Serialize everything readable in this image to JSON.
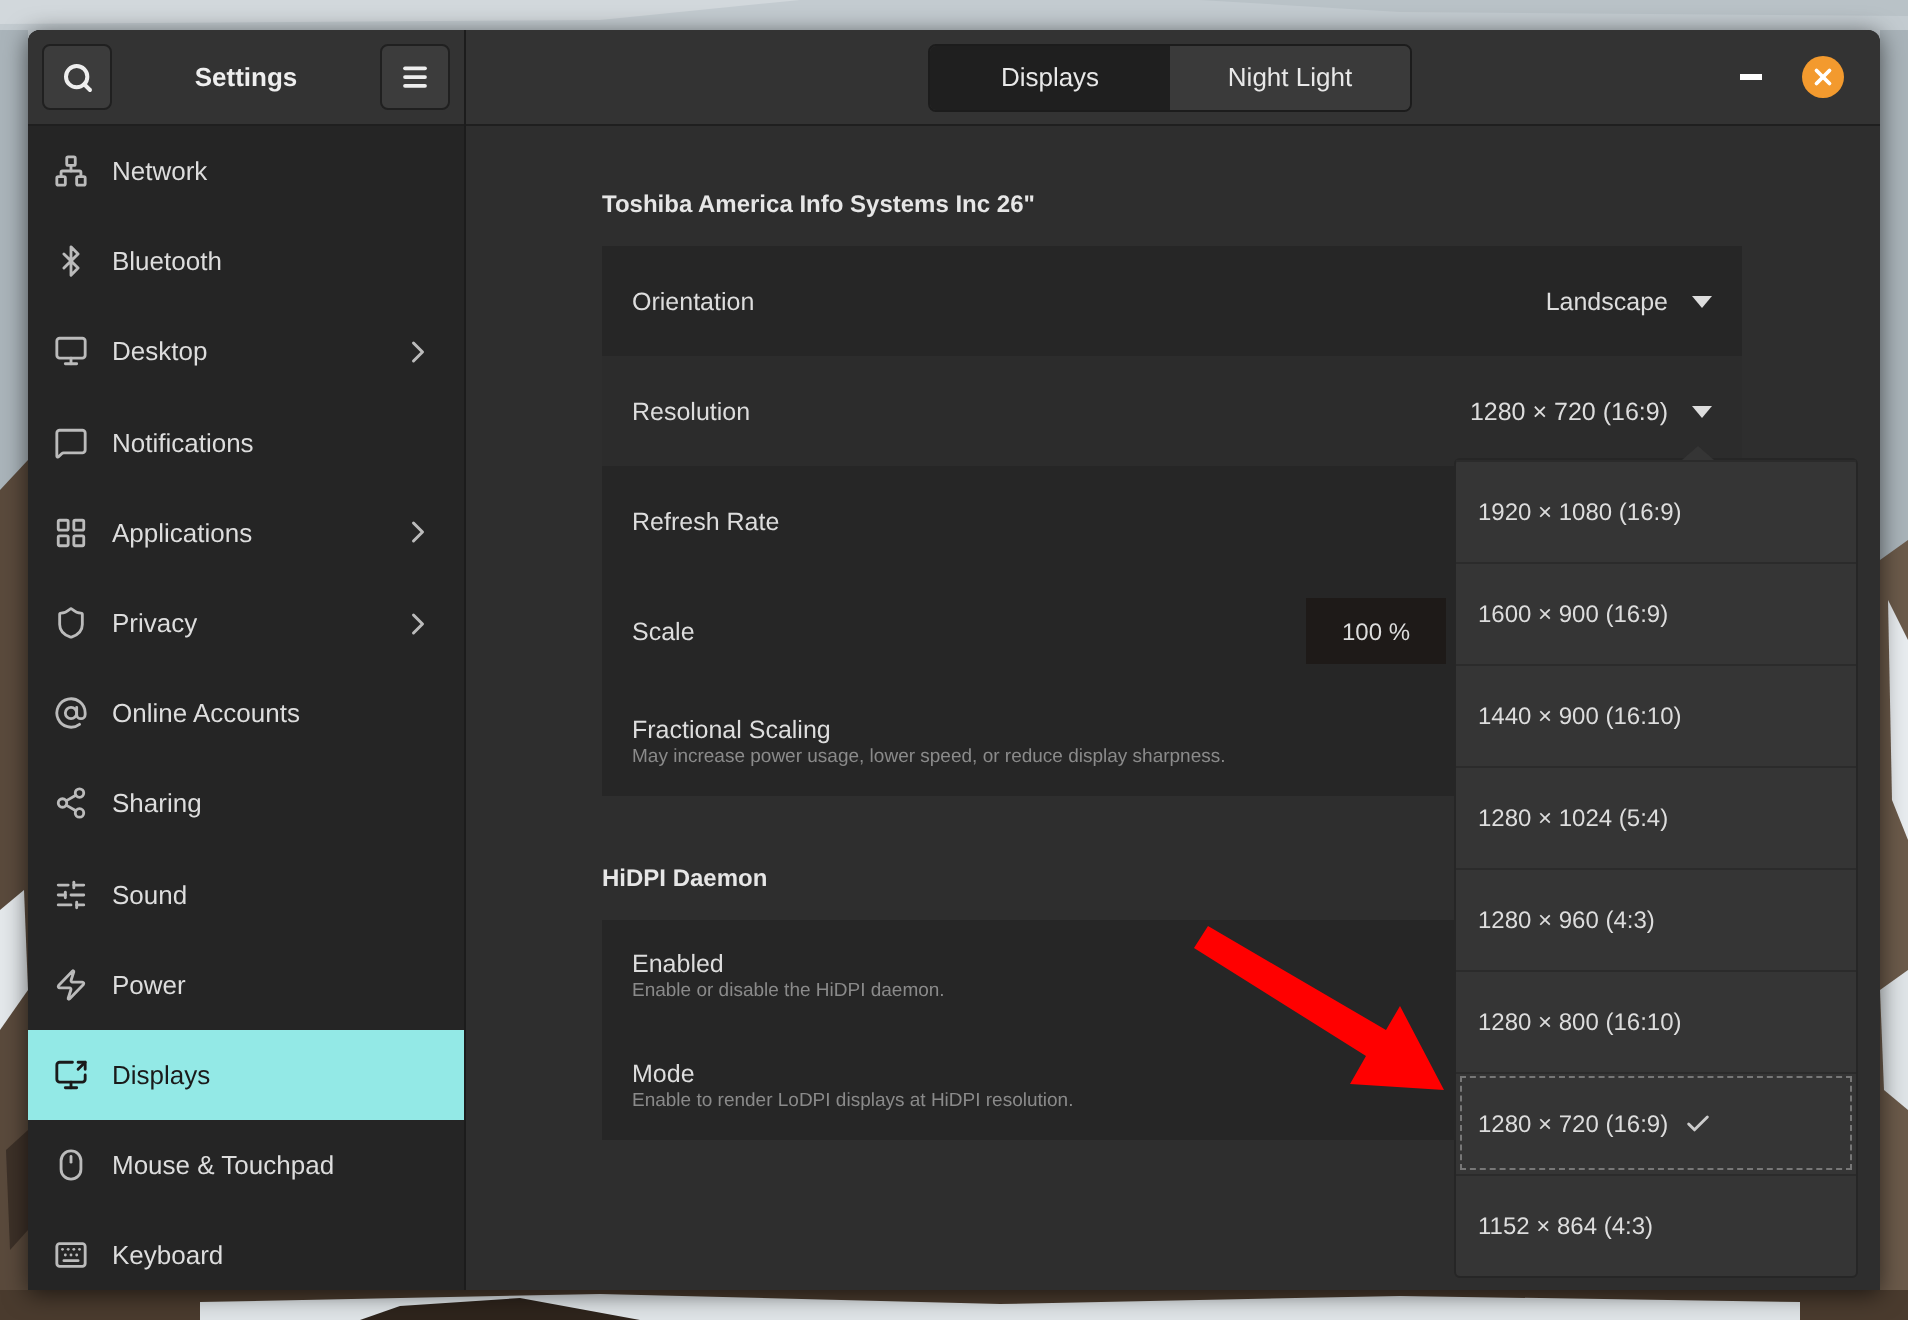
{
  "window": {
    "title": "Settings"
  },
  "header_tabs": [
    {
      "label": "Displays",
      "selected": true
    },
    {
      "label": "Night Light",
      "selected": false
    }
  ],
  "sidebar": {
    "items": [
      {
        "label": "Network",
        "has_submenu": false,
        "selected": false
      },
      {
        "label": "Bluetooth",
        "has_submenu": false,
        "selected": false
      },
      {
        "label": "Desktop",
        "has_submenu": true,
        "selected": false
      },
      {
        "label": "Notifications",
        "has_submenu": false,
        "selected": false
      },
      {
        "label": "Applications",
        "has_submenu": true,
        "selected": false
      },
      {
        "label": "Privacy",
        "has_submenu": true,
        "selected": false
      },
      {
        "label": "Online Accounts",
        "has_submenu": false,
        "selected": false
      },
      {
        "label": "Sharing",
        "has_submenu": false,
        "selected": false
      },
      {
        "label": "Sound",
        "has_submenu": false,
        "selected": false
      },
      {
        "label": "Power",
        "has_submenu": false,
        "selected": false
      },
      {
        "label": "Displays",
        "has_submenu": false,
        "selected": true
      },
      {
        "label": "Mouse & Touchpad",
        "has_submenu": false,
        "selected": false
      },
      {
        "label": "Keyboard",
        "has_submenu": false,
        "selected": false
      }
    ]
  },
  "display_section": {
    "title": "Toshiba America Info Systems Inc 26\"",
    "rows": [
      {
        "kind": "dropdown",
        "label": "Orientation",
        "value": "Landscape"
      },
      {
        "kind": "dropdown",
        "label": "Resolution",
        "value": "1280 × 720 (16:9)"
      },
      {
        "kind": "plain",
        "label": "Refresh Rate"
      },
      {
        "kind": "button",
        "label": "Scale",
        "value": "100 %"
      },
      {
        "kind": "plain",
        "label": "Fractional Scaling",
        "subtitle": "May increase power usage, lower speed, or reduce display sharpness."
      }
    ]
  },
  "hidpi_section": {
    "title": "HiDPI Daemon",
    "rows": [
      {
        "kind": "plain",
        "label": "Enabled",
        "subtitle": "Enable or disable the HiDPI daemon."
      },
      {
        "kind": "plain",
        "label": "Mode",
        "subtitle": "Enable to render LoDPI displays at HiDPI resolution."
      }
    ]
  },
  "resolution_menu": {
    "options": [
      {
        "label": "1920 × 1080 (16:9)",
        "selected": false
      },
      {
        "label": "1600 × 900 (16:9)",
        "selected": false
      },
      {
        "label": "1440 × 900 (16:10)",
        "selected": false
      },
      {
        "label": "1280 × 1024 (5:4)",
        "selected": false
      },
      {
        "label": "1280 × 960 (4:3)",
        "selected": false
      },
      {
        "label": "1280 × 800 (16:10)",
        "selected": false
      },
      {
        "label": "1280 × 720 (16:9)",
        "selected": true
      },
      {
        "label": "1152 × 864 (4:3)",
        "selected": false
      }
    ]
  }
}
